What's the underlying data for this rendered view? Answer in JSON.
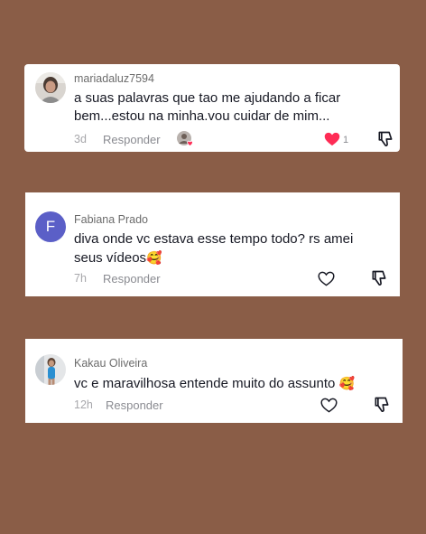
{
  "comments": [
    {
      "username": "mariadaluz7594",
      "line1": "a suas palavras que tao me ajudando a ficar",
      "line2": "bem...estou na minha.vou cuidar de mim...",
      "time": "3d",
      "reply_label": "Responder",
      "like_count": "1",
      "liked": true,
      "like_color": "#fe2c55"
    },
    {
      "username": "Fabiana Prado",
      "avatar_letter": "F",
      "avatar_color": "#5b5fc7",
      "line1": "diva onde vc estava esse tempo todo? rs amei",
      "line2": "seus vídeos",
      "emoji": "🥰",
      "time": "7h",
      "reply_label": "Responder"
    },
    {
      "username": "Kakau Oliveira",
      "line1": "vc e maravilhosa entende muito do assunto",
      "emoji": "🥰",
      "time": "12h",
      "reply_label": "Responder"
    }
  ]
}
